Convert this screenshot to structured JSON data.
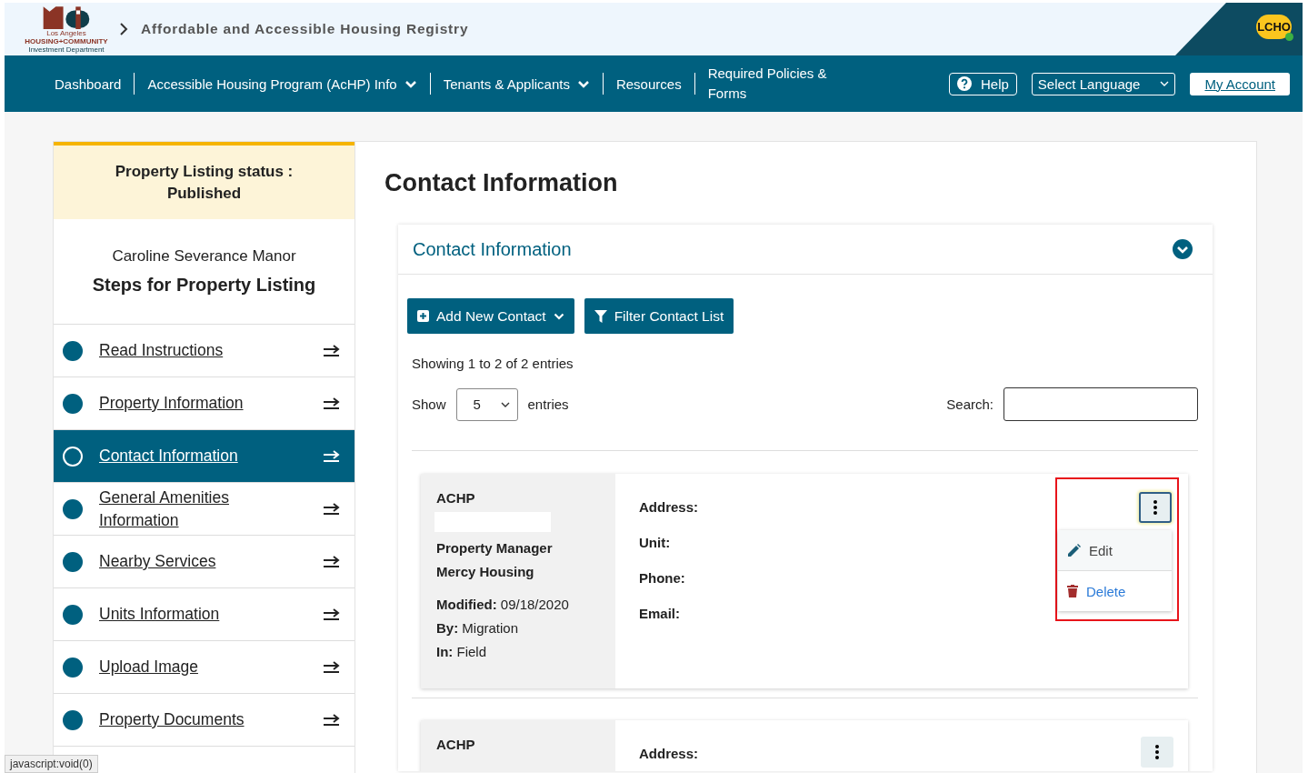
{
  "header": {
    "logo_lines": [
      "Los Angeles",
      "HOUSING+COMMUNITY",
      "Investment Department"
    ],
    "title": "Affordable and Accessible Housing Registry",
    "user_badge": "LCHO",
    "user_online": true
  },
  "nav": {
    "items": [
      {
        "label": "Dashboard",
        "dropdown": false
      },
      {
        "label": "Accessible Housing Program (AcHP) Info",
        "dropdown": true
      },
      {
        "label": "Tenants & Applicants",
        "dropdown": true
      },
      {
        "label": "Resources",
        "dropdown": false
      },
      {
        "label": "Required Policies & Forms",
        "dropdown": false
      }
    ],
    "help": "Help",
    "language": "Select Language",
    "account": "My Account"
  },
  "sidebar": {
    "status_label": "Property Listing status :",
    "status_value": "Published",
    "property_name": "Caroline Severance Manor",
    "steps_title": "Steps for Property Listing",
    "steps": [
      {
        "label": "Read Instructions",
        "selected": false
      },
      {
        "label": "Property Information",
        "selected": false
      },
      {
        "label": "Contact Information",
        "selected": true
      },
      {
        "label": "General Amenities Information",
        "selected": false
      },
      {
        "label": "Nearby Services",
        "selected": false
      },
      {
        "label": "Units Information",
        "selected": false
      },
      {
        "label": "Upload Image",
        "selected": false
      },
      {
        "label": "Property Documents",
        "selected": false
      }
    ]
  },
  "main": {
    "title": "Contact Information",
    "section": {
      "title": "Contact Information",
      "expanded": true
    },
    "buttons": [
      {
        "label": "Add New Contact",
        "kind": "add"
      },
      {
        "label": "Filter Contact List",
        "kind": "filter"
      }
    ],
    "info": "Showing 1 to 2 of 2 entries",
    "show_label": "Show",
    "page_size": "5",
    "entries_label": "entries",
    "search_label": "Search:",
    "contacts": [
      {
        "program": "ACHP",
        "name_redacted": true,
        "details": [
          "Property Manager",
          "Mercy Housing"
        ],
        "meta": [
          "**Modified:** 09/18/2020",
          "**By:** Migration",
          "**In:** Field"
        ],
        "fields": [
          "Address:",
          "Unit:",
          "Phone:",
          "Email:"
        ],
        "menu_open": true,
        "highlighted": true,
        "menu": [
          {
            "label": "Edit",
            "kind": "edit"
          },
          {
            "label": "Delete",
            "kind": "delete"
          }
        ]
      },
      {
        "program": "ACHP",
        "name_redacted": false,
        "fields": [
          "Address:"
        ],
        "menu_open": false,
        "highlighted": false
      }
    ]
  },
  "status_url": "javascript:void(0)"
}
